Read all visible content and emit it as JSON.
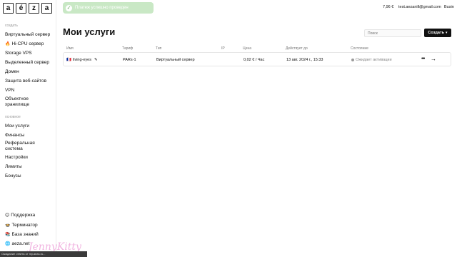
{
  "logo": {
    "letters": [
      "a",
      "é",
      "z",
      "a"
    ]
  },
  "sidebar": {
    "section_create": "создать",
    "create_items": [
      {
        "label": "Виртуальный сервер"
      },
      {
        "emoji": "🔥",
        "label": "Hi-CPU сервер"
      },
      {
        "label": "Storage VPS"
      },
      {
        "label": "Выделенный сервер"
      },
      {
        "label": "Домен"
      },
      {
        "label": "Защита веб-сайтов"
      },
      {
        "label": "VPN"
      },
      {
        "label": "Объектное хранилище"
      }
    ],
    "section_general": "основное",
    "general_items": [
      {
        "label": "Мои услуги"
      },
      {
        "label": "Финансы"
      },
      {
        "label": "Реферальная система"
      },
      {
        "label": "Настройки"
      },
      {
        "label": "Лимиты"
      },
      {
        "label": "Бонусы"
      }
    ],
    "footer_items": [
      {
        "emoji": "😊",
        "label": "Поддержка"
      },
      {
        "emoji": "🍲",
        "label": "Терминатор"
      },
      {
        "emoji": "📚",
        "label": "База знаний"
      },
      {
        "emoji": "🌐",
        "label": "aeza.net"
      }
    ]
  },
  "topbar": {
    "toast": "Платеж успешно проведен",
    "balance": "7,96 €",
    "email": "test.aezanill@gmail.com",
    "business": "Busin"
  },
  "main": {
    "title": "Мои услуги",
    "search_placeholder": "Поиск",
    "create_button": "Создать",
    "columns": [
      "Имя",
      "Тариф",
      "Тип",
      "IP",
      "Цена",
      "Действует до",
      "Состояние"
    ],
    "rows": [
      {
        "flag": "🇫🇷",
        "name": "living-eyes",
        "tariff": "PARs-1",
        "type": "Виртуальный сервер",
        "ip": "",
        "price": "0,02 € / Час",
        "until": "13 авг. 2024 г., 15:33",
        "status": "Ожидает активации"
      }
    ]
  },
  "overlay": {
    "status_bar": "Ожидание ответа от my.aeza.ru...",
    "watermark": "JennyKitty"
  },
  "colors": {
    "toast_bg": "#c9e8c5",
    "toast_check": "#5aa653",
    "button_bg": "#111111"
  }
}
